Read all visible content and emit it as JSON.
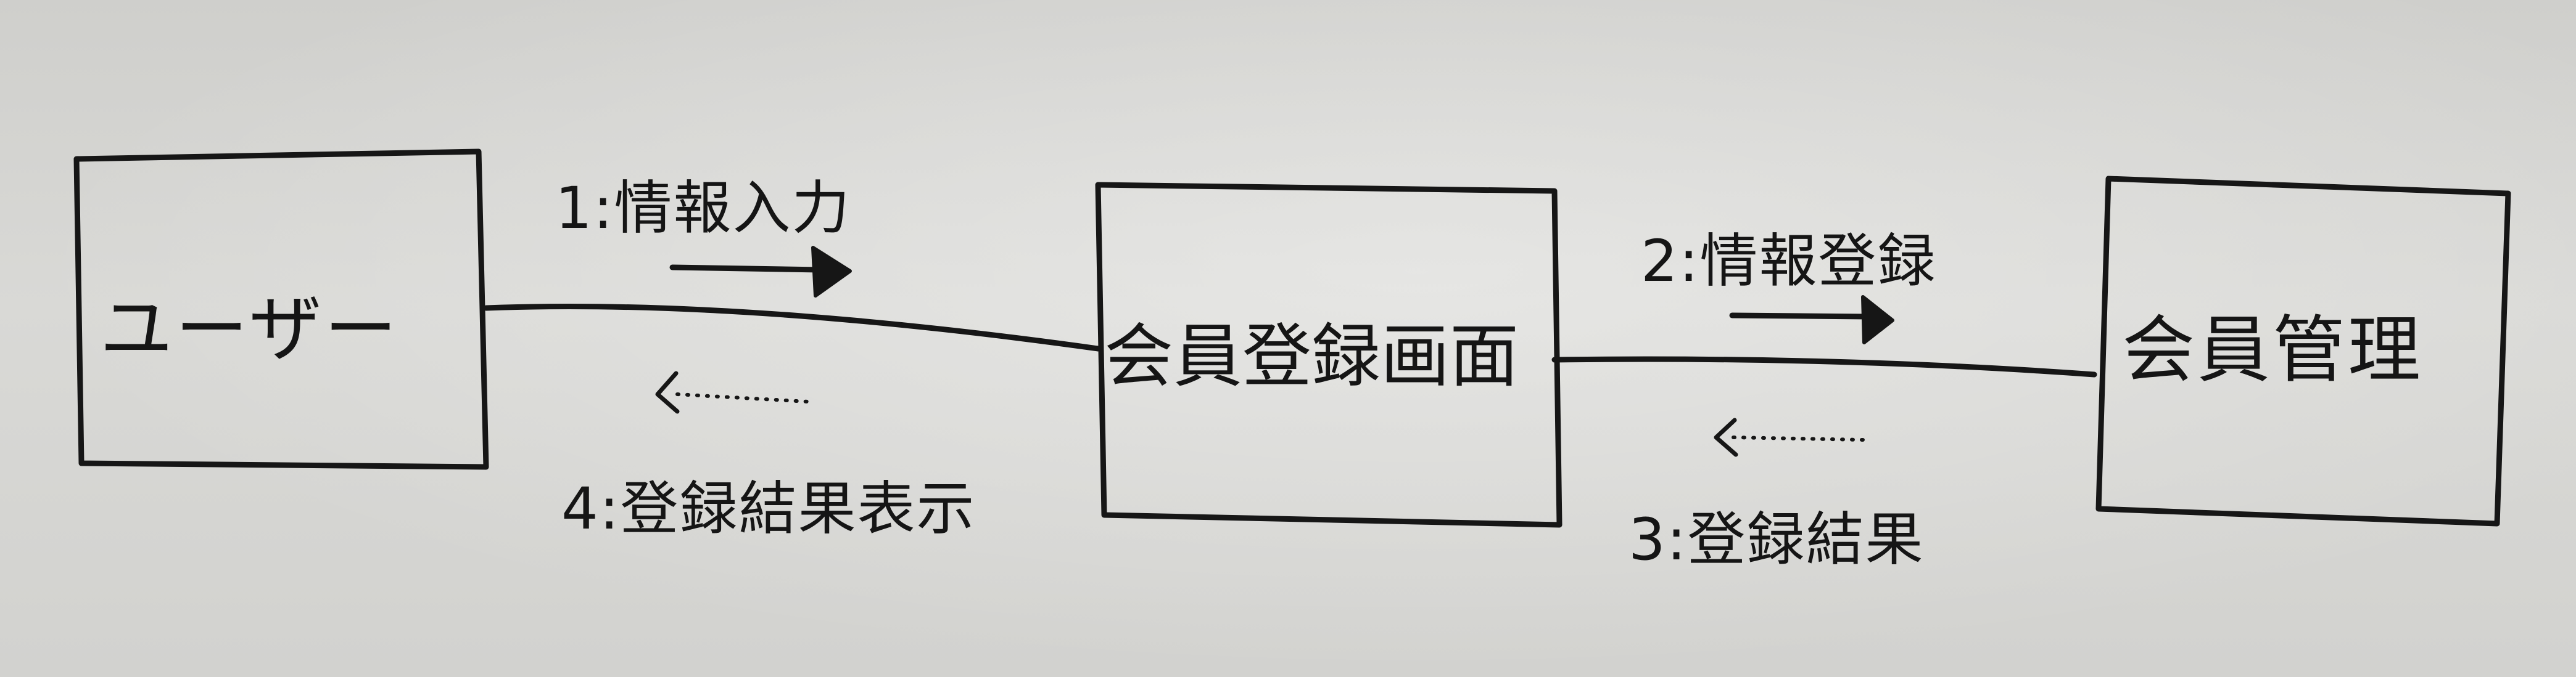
{
  "diagram": {
    "nodes": {
      "user": "ユーザー",
      "registration_screen": "会員登録画面",
      "member_management": "会員管理"
    },
    "messages": {
      "m1": "1:情報入力",
      "m2": "2:情報登録",
      "m3": "3:登録結果",
      "m4": "4:登録結果表示"
    }
  }
}
